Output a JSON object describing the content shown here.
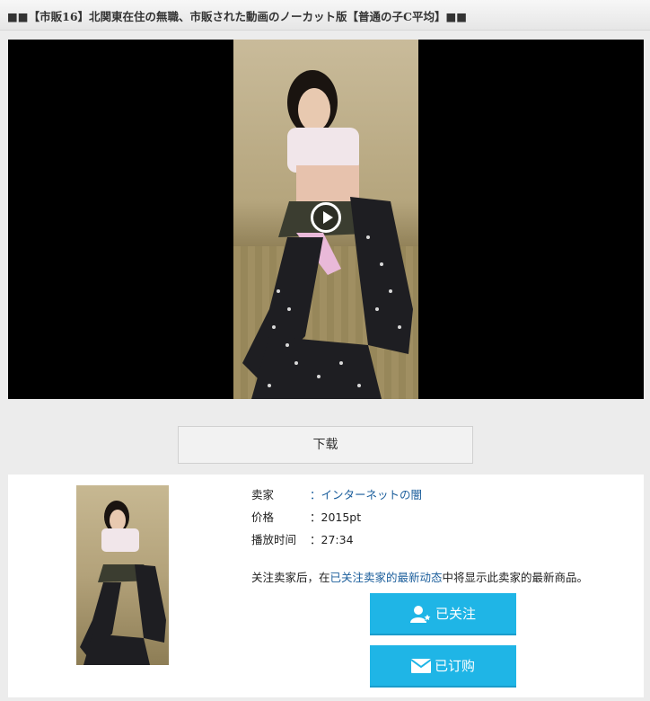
{
  "title": "■■【市販16】北関東在住の無職、市販された動画のノーカット版【普通の子C平均】■■",
  "player": {
    "play_icon": "play-icon"
  },
  "download": {
    "label": "下载"
  },
  "seller": {
    "rows": [
      {
        "key": "卖家",
        "value": "：インターネットの闇"
      },
      {
        "key": "价格",
        "value": "：2015pt"
      },
      {
        "key": "播放时间",
        "value": "：27:34"
      }
    ],
    "note_before": "关注卖家后，在",
    "note_link": "已关注卖家的最新动态",
    "note_after": "中将显示此卖家的最新商品。",
    "follow_label": "已关注",
    "follow_icon": "user-star-icon",
    "subscribe_label": "已订购",
    "subscribe_icon": "mail-icon"
  },
  "colors": {
    "accent": "#1fb5e6",
    "link": "#1a5d9b"
  }
}
